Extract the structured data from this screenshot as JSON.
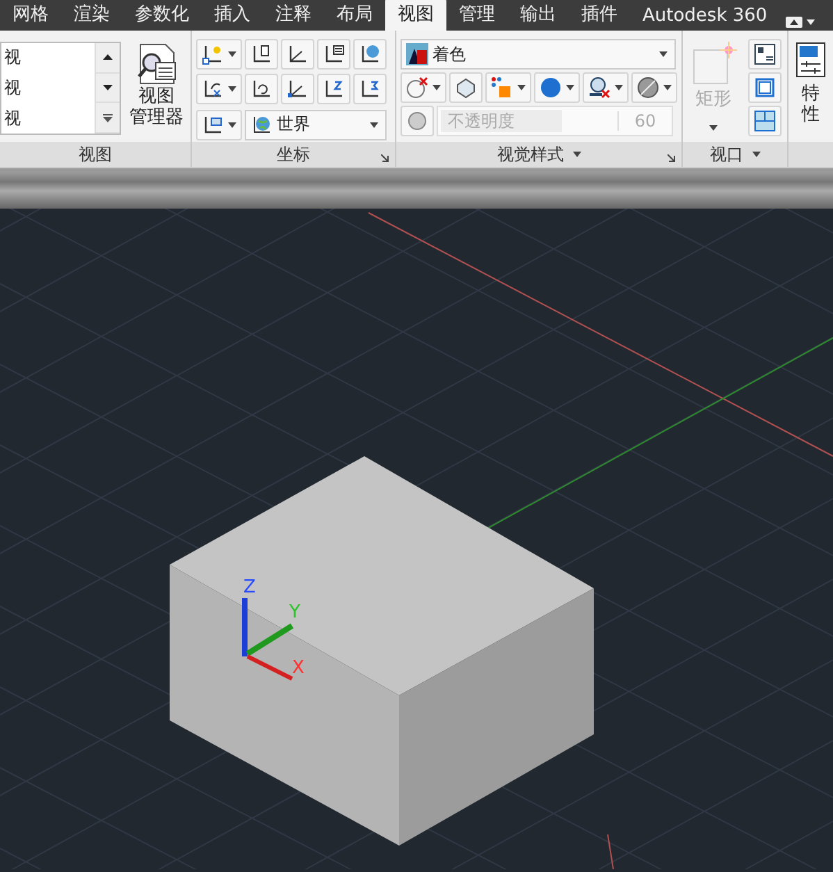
{
  "tabs": [
    {
      "label": "网格",
      "selected": false
    },
    {
      "label": "渲染",
      "selected": false
    },
    {
      "label": "参数化",
      "selected": false
    },
    {
      "label": "插入",
      "selected": false
    },
    {
      "label": "注释",
      "selected": false
    },
    {
      "label": "布局",
      "selected": false
    },
    {
      "label": "视图",
      "selected": true
    },
    {
      "label": "管理",
      "selected": false
    },
    {
      "label": "输出",
      "selected": false
    },
    {
      "label": "插件",
      "selected": false
    },
    {
      "label": "Autodesk 360",
      "selected": false
    }
  ],
  "view_panel": {
    "title": "视图",
    "view_list": [
      "视",
      "视",
      "视"
    ],
    "manager_button": [
      "视图",
      "管理器"
    ]
  },
  "coordinates_panel": {
    "title": "坐标",
    "ucs_dropdown": "世界"
  },
  "visual_styles_panel": {
    "title": "视觉样式",
    "style_dropdown": "着色",
    "opacity": {
      "label": "不透明度",
      "value": "60",
      "disabled": true
    }
  },
  "viewports_panel": {
    "title": "视口",
    "rectangle_button": {
      "label": "矩形",
      "disabled": true
    }
  },
  "properties_panel": {
    "button": "特性"
  },
  "viewport": {
    "ucs_icon": {
      "z": "Z",
      "y": "Y",
      "x": "X"
    }
  }
}
